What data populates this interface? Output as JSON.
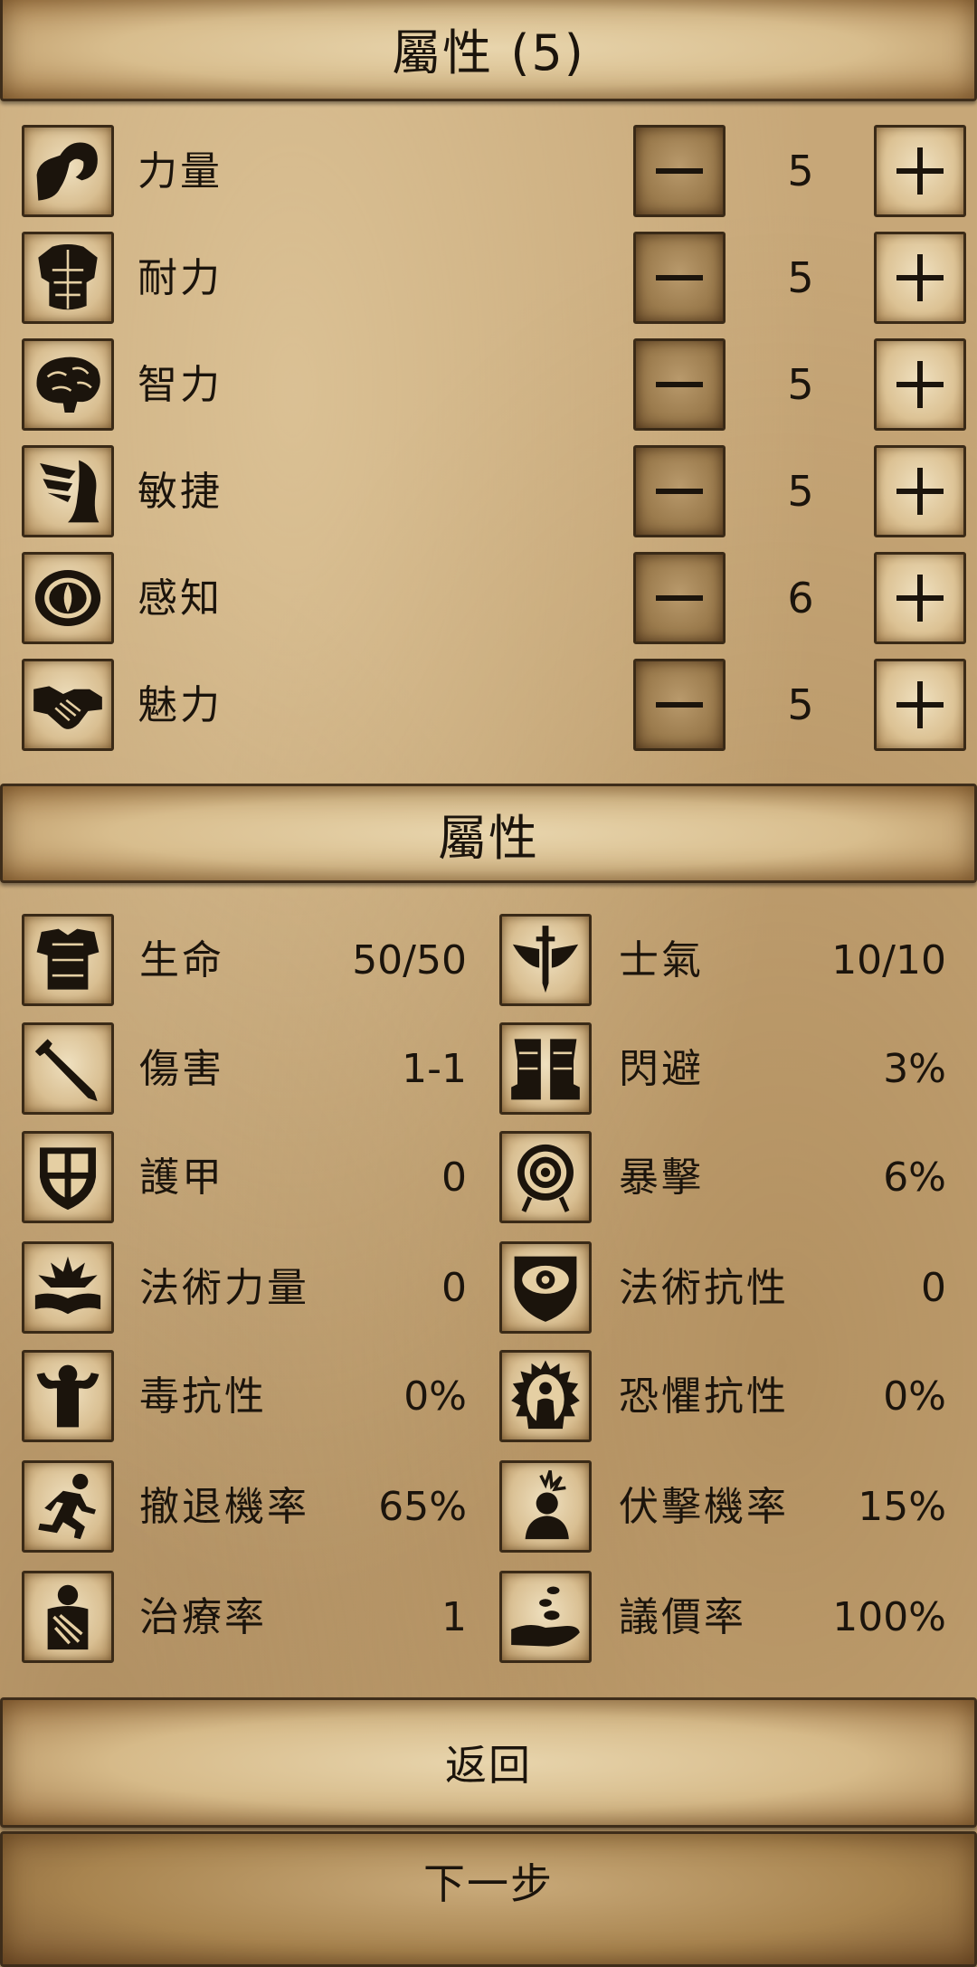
{
  "header": {
    "title": "屬性 (5)"
  },
  "attributes": [
    {
      "label": "力量",
      "value": "5",
      "icon": "flexed-arm-icon"
    },
    {
      "label": "耐力",
      "value": "5",
      "icon": "torso-armor-icon"
    },
    {
      "label": "智力",
      "value": "5",
      "icon": "brain-icon"
    },
    {
      "label": "敏捷",
      "value": "5",
      "icon": "winged-foot-icon"
    },
    {
      "label": "感知",
      "value": "6",
      "icon": "eye-icon"
    },
    {
      "label": "魅力",
      "value": "5",
      "icon": "handshake-icon"
    }
  ],
  "stats_header": {
    "title": "屬性"
  },
  "stats_left": [
    {
      "label": "生命",
      "value": "50/50",
      "icon": "chest-armor-icon"
    },
    {
      "label": "傷害",
      "value": "1-1",
      "icon": "sword-icon"
    },
    {
      "label": "護甲",
      "value": "0",
      "icon": "shield-icon"
    },
    {
      "label": "法術力量",
      "value": "0",
      "icon": "spellbook-icon"
    },
    {
      "label": "毒抗性",
      "value": "0%",
      "icon": "strongman-icon"
    },
    {
      "label": "撤退機率",
      "value": "65%",
      "icon": "running-man-icon"
    },
    {
      "label": "治療率",
      "value": "1",
      "icon": "bandaged-man-icon"
    }
  ],
  "stats_right": [
    {
      "label": "士氣",
      "value": "10/10",
      "icon": "winged-sword-icon"
    },
    {
      "label": "閃避",
      "value": "3%",
      "icon": "boots-icon"
    },
    {
      "label": "暴擊",
      "value": "6%",
      "icon": "target-icon"
    },
    {
      "label": "法術抗性",
      "value": "0",
      "icon": "eye-shield-icon"
    },
    {
      "label": "恐懼抗性",
      "value": "0%",
      "icon": "aura-figure-icon"
    },
    {
      "label": "伏擊機率",
      "value": "15%",
      "icon": "ambush-figure-icon"
    },
    {
      "label": "議價率",
      "value": "100%",
      "icon": "coins-hand-icon"
    }
  ],
  "buttons": {
    "back": "返回",
    "next": "下一步"
  }
}
